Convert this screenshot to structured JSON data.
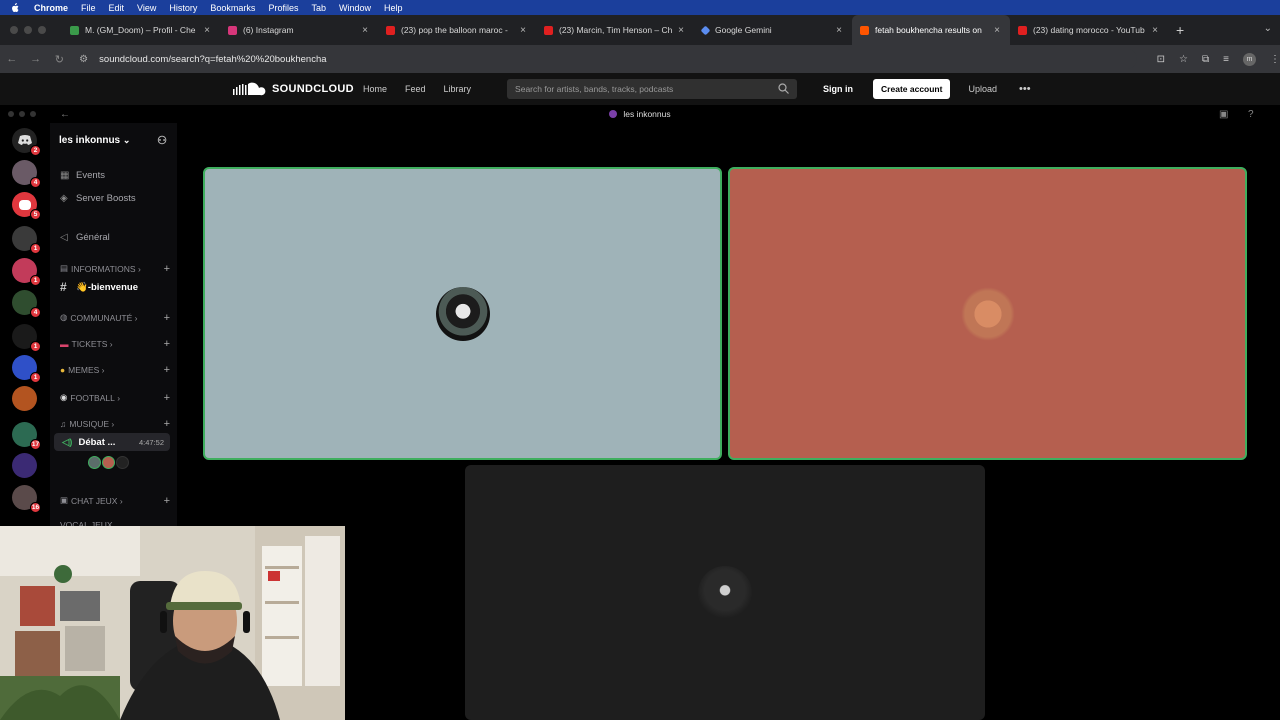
{
  "menubar": {
    "app": "Chrome",
    "items": [
      "File",
      "Edit",
      "View",
      "History",
      "Bookmarks",
      "Profiles",
      "Tab",
      "Window",
      "Help"
    ]
  },
  "tabs": [
    {
      "title": "M. (GM_Doom) – Profil - Che",
      "color": "#3a9a4a"
    },
    {
      "title": "Instagram",
      "prefix": "(6)",
      "color": "#d6367a"
    },
    {
      "title": "(23) pop the balloon maroc -",
      "color": "#e02020"
    },
    {
      "title": "(23) Marcin, Tim Henson – Ch",
      "color": "#e02020"
    },
    {
      "title": "Google Gemini",
      "color": "#5b8df0"
    },
    {
      "title": "fetah boukhencha results on",
      "color": "#ff5500"
    },
    {
      "title": "(23) dating morocco - YouTub",
      "color": "#e02020"
    }
  ],
  "address": {
    "url": "soundcloud.com/search?q=fetah%20%20boukhencha"
  },
  "soundcloud": {
    "logo": "SOUNDCLOUD",
    "nav": [
      "Home",
      "Feed",
      "Library"
    ],
    "search_placeholder": "Search for artists, bands, tracks, podcasts",
    "signin": "Sign in",
    "create": "Create account",
    "upload": "Upload"
  },
  "discord": {
    "window_title": "les inkonnus",
    "guild_name": "les inkonnus",
    "server_badges": [
      "2",
      "4",
      "5",
      "1",
      "1",
      "4",
      "1",
      "1",
      "17",
      "16"
    ],
    "channels": {
      "events": "Events",
      "boosts": "Server Boosts",
      "general": "Général",
      "cat_info": "INFORMATIONS",
      "bienvenue": "👋-bienvenue",
      "cat_communaute": "COMMUNAUTÉ",
      "cat_tickets": "TICKETS",
      "cat_memes": "MEMES",
      "cat_football": "FOOTBALL",
      "cat_musique": "MUSIQUE",
      "voice_channel": "Débat ...",
      "voice_time": "4:47:52",
      "cat_chat_jeux": "CHAT JEUX",
      "cat_vocal_jeux": "VOCAL JEUX"
    },
    "tiles": [
      {
        "bg": "#9fb3b8",
        "speaking": true
      },
      {
        "bg": "#b55f4f",
        "speaking": true
      },
      {
        "bg": "#1e1e1e",
        "speaking": false
      }
    ]
  },
  "colors": {
    "accent_green": "#3fae5e",
    "badge_red": "#e0373e",
    "soundcloud_orange": "#ff5500"
  }
}
